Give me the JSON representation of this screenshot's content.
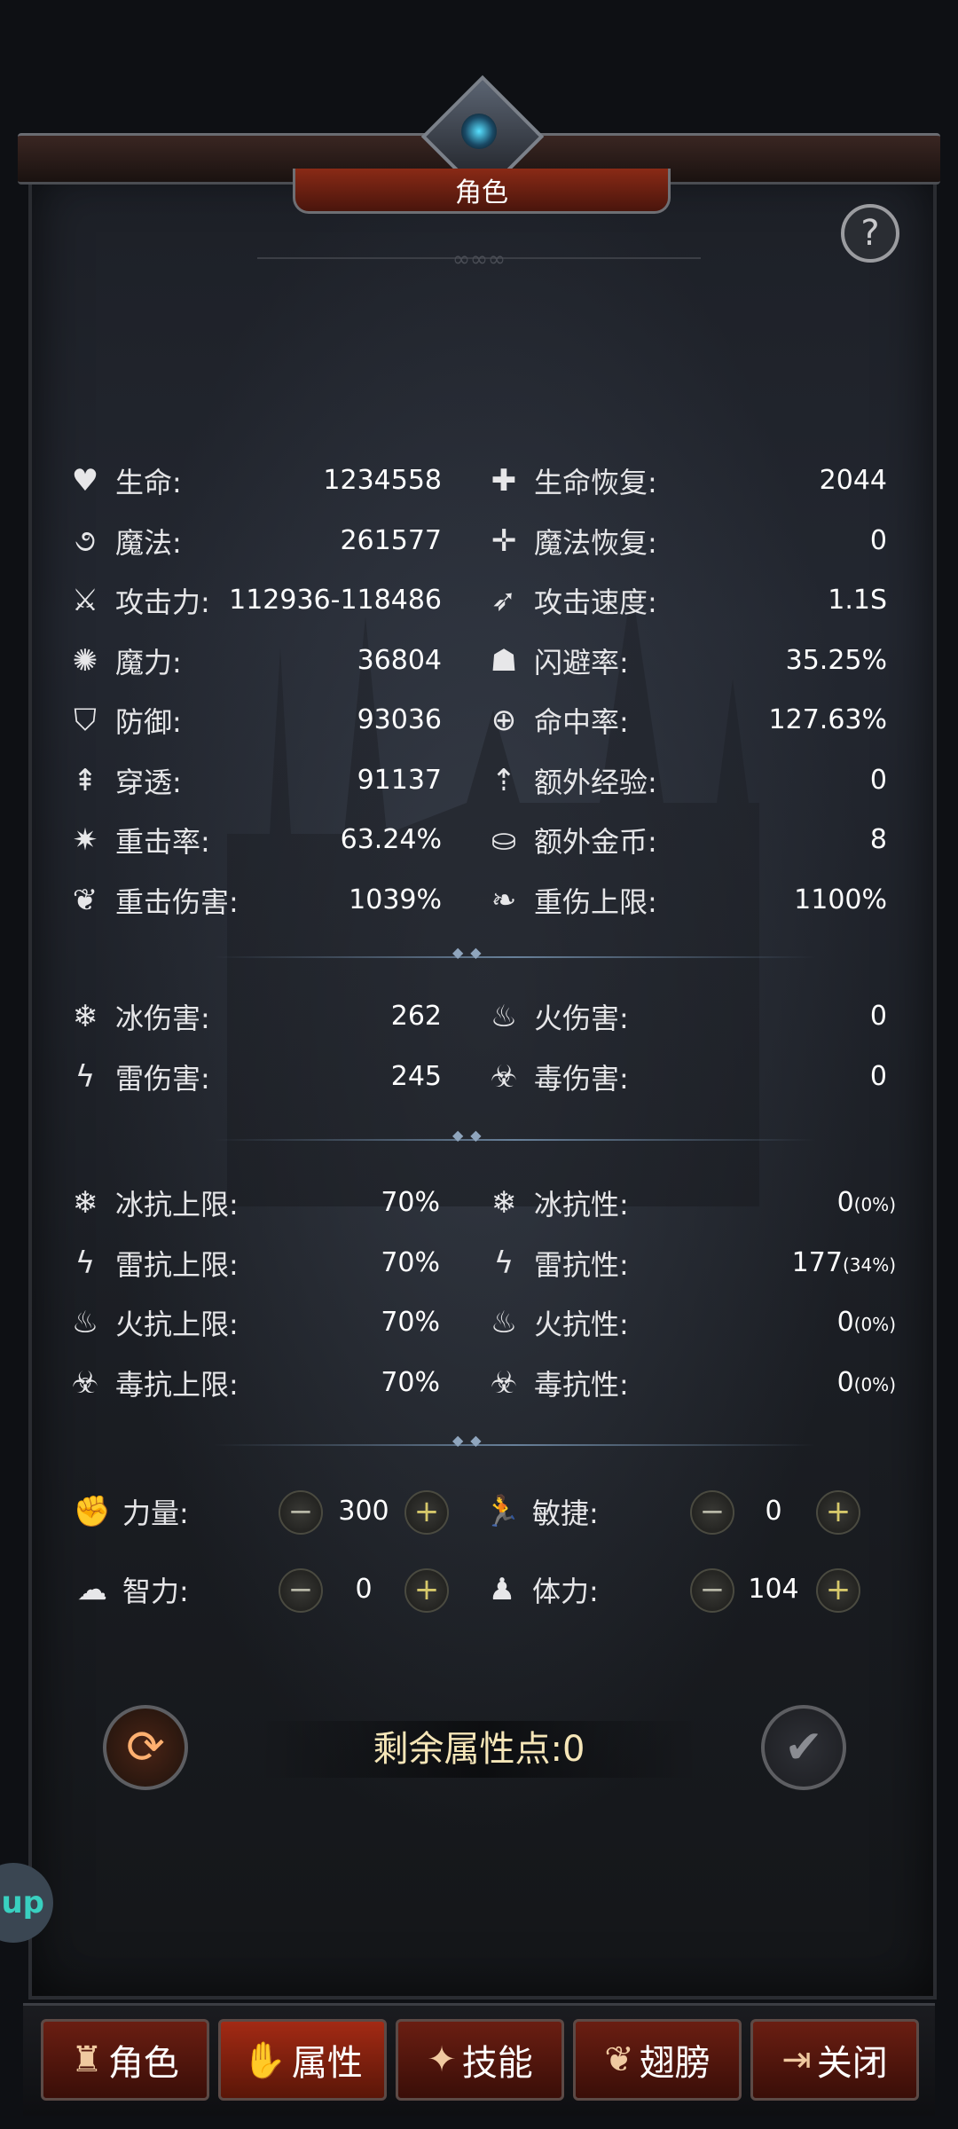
{
  "window": {
    "title": "角色",
    "help": "?"
  },
  "basic_stats": {
    "left": [
      {
        "icon": "heart-icon",
        "glyph": "♥",
        "label": "生命:",
        "value": "1234558"
      },
      {
        "icon": "swirl-icon",
        "glyph": "૭",
        "label": "魔法:",
        "value": "261577"
      },
      {
        "icon": "sword-icon",
        "glyph": "⚔",
        "label": "攻击力:",
        "value": "112936-118486"
      },
      {
        "icon": "magic-icon",
        "glyph": "✺",
        "label": "魔力:",
        "value": "36804"
      },
      {
        "icon": "shield-icon",
        "glyph": "⛉",
        "label": "防御:",
        "value": "93036"
      },
      {
        "icon": "pierce-icon",
        "glyph": "⇞",
        "label": "穿透:",
        "value": "91137"
      },
      {
        "icon": "crit-icon",
        "glyph": "✷",
        "label": "重击率:",
        "value": "63.24%"
      },
      {
        "icon": "crit-damage-icon",
        "glyph": "❦",
        "label": "重击伤害:",
        "value": "1039%"
      }
    ],
    "right": [
      {
        "icon": "life-regen-icon",
        "glyph": "✚",
        "label": "生命恢复:",
        "value": "2044"
      },
      {
        "icon": "mana-regen-icon",
        "glyph": "✛",
        "label": "魔法恢复:",
        "value": "0"
      },
      {
        "icon": "attack-speed-icon",
        "glyph": "➶",
        "label": "攻击速度:",
        "value": "1.1S"
      },
      {
        "icon": "dodge-icon",
        "glyph": "☗",
        "label": "闪避率:",
        "value": "35.25%"
      },
      {
        "icon": "target-icon",
        "glyph": "⊕",
        "label": "命中率:",
        "value": "127.63%"
      },
      {
        "icon": "exp-icon",
        "glyph": "⇡",
        "label": "额外经验:",
        "value": "0"
      },
      {
        "icon": "gold-icon",
        "glyph": "⛀",
        "label": "额外金币:",
        "value": "8"
      },
      {
        "icon": "crit-cap-icon",
        "glyph": "❧",
        "label": "重伤上限:",
        "value": "1100%"
      }
    ]
  },
  "element_damage": {
    "left": [
      {
        "icon": "ice-icon",
        "glyph": "❄",
        "label": "冰伤害:",
        "value": "262"
      },
      {
        "icon": "lightning-icon",
        "glyph": "ϟ",
        "label": "雷伤害:",
        "value": "245"
      }
    ],
    "right": [
      {
        "icon": "fire-icon",
        "glyph": "♨",
        "label": "火伤害:",
        "value": "0"
      },
      {
        "icon": "poison-icon",
        "glyph": "☣",
        "label": "毒伤害:",
        "value": "0"
      }
    ]
  },
  "resistances": {
    "left": [
      {
        "icon": "ice-cap-icon",
        "glyph": "❄",
        "label": "冰抗上限:",
        "value": "70%"
      },
      {
        "icon": "lightning-cap-icon",
        "glyph": "ϟ",
        "label": "雷抗上限:",
        "value": "70%"
      },
      {
        "icon": "fire-cap-icon",
        "glyph": "♨",
        "label": "火抗上限:",
        "value": "70%"
      },
      {
        "icon": "poison-cap-icon",
        "glyph": "☣",
        "label": "毒抗上限:",
        "value": "70%"
      }
    ],
    "right": [
      {
        "icon": "ice-resist-icon",
        "glyph": "❄",
        "label": "冰抗性:",
        "value": "0",
        "pct": "(0%)"
      },
      {
        "icon": "lightning-resist-icon",
        "glyph": "ϟ",
        "label": "雷抗性:",
        "value": "177",
        "pct": "(34%)"
      },
      {
        "icon": "fire-resist-icon",
        "glyph": "♨",
        "label": "火抗性:",
        "value": "0",
        "pct": "(0%)"
      },
      {
        "icon": "poison-resist-icon",
        "glyph": "☣",
        "label": "毒抗性:",
        "value": "0",
        "pct": "(0%)"
      }
    ]
  },
  "attributes": [
    {
      "icon": "strength-icon",
      "glyph": "✊",
      "label": "力量:",
      "value": "300"
    },
    {
      "icon": "agility-icon",
      "glyph": "🏃",
      "label": "敏捷:",
      "value": "0"
    },
    {
      "icon": "intellect-icon",
      "glyph": "☁",
      "label": "智力:",
      "value": "0"
    },
    {
      "icon": "stamina-icon",
      "glyph": "♟",
      "label": "体力:",
      "value": "104"
    }
  ],
  "remaining_points": "剩余属性点:0",
  "side_tab": "up",
  "bottom_tabs": [
    {
      "icon": "character-tab-icon",
      "glyph": "♜",
      "label": "角色"
    },
    {
      "icon": "attribute-tab-icon",
      "glyph": "✋",
      "label": "属性"
    },
    {
      "icon": "skill-tab-icon",
      "glyph": "✦",
      "label": "技能"
    },
    {
      "icon": "wings-tab-icon",
      "glyph": "❦",
      "label": "翅膀"
    },
    {
      "icon": "exit-tab-icon",
      "glyph": "⇥",
      "label": "关闭"
    }
  ]
}
